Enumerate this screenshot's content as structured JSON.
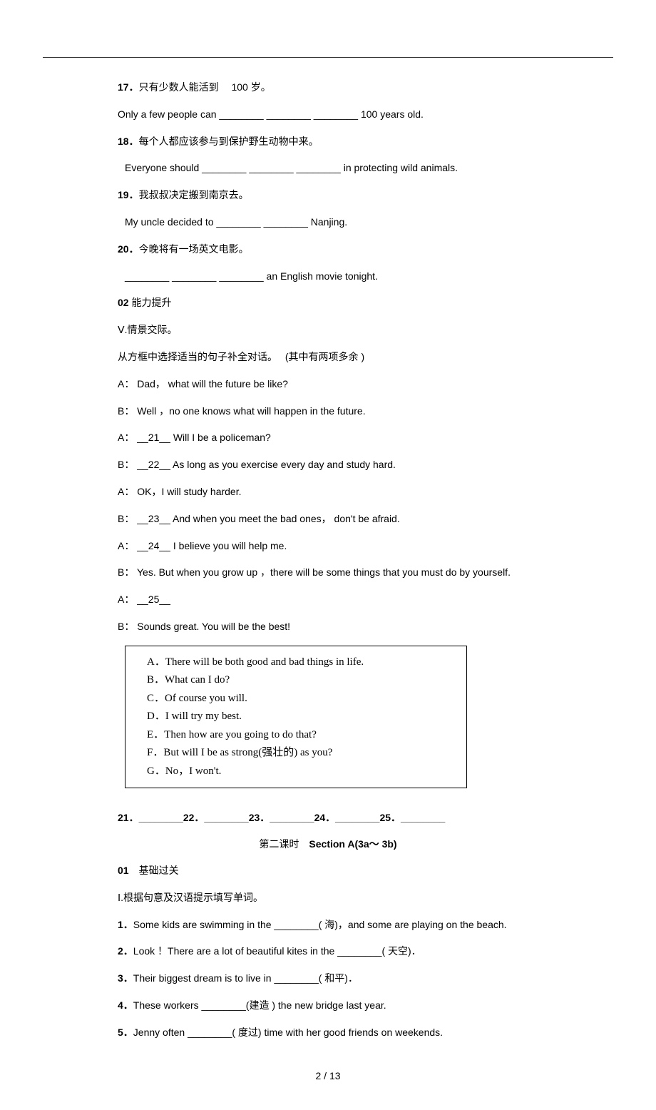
{
  "q17": {
    "num": "17．",
    "zh": "只有少数人能活到　 100 岁。",
    "en": "Only a few people can ________ ________ ________ 100 years old."
  },
  "q18": {
    "num": "18．",
    "zh": "每个人都应该参与到保护野生动物中来。",
    "en": "Everyone should ________ ________ ________ in protecting wild animals."
  },
  "q19": {
    "num": "19．",
    "zh": "我叔叔决定搬到南京去。",
    "en": "My uncle decided to ________ ________ Nanjing."
  },
  "q20": {
    "num": "20．",
    "zh": "今晚将有一场英文电影。",
    "en": "________ ________ ________ an English movie tonight."
  },
  "sec02": {
    "label": "02",
    "title": "能力提升"
  },
  "part5": {
    "label": "Ⅴ.情景交际。",
    "instr": "从方框中选择适当的句子补全对话。　 (其中有两项多余  )"
  },
  "dialogue": [
    "A： Dad， what will the future be like?",
    "B： Well ，no one knows what will happen in the future.",
    "A： __21__ Will I be a policeman?",
    "B： __22__ As long as you exercise every day and study hard.",
    "A： OK，I will study harder.",
    "B： __23__ And when you meet the bad ones， don't be afraid.",
    "A： __24__ I believe you will help me.",
    "B： Yes. But when you grow up  ，there will be some things that you must do by yourself.",
    "A： __25__",
    "B： Sounds great. You will be the best!"
  ],
  "options": [
    "A．There will be both good and bad things in life.",
    "B．What can I do?",
    "C．Of course you will.",
    "D．I will try my best.",
    "E．Then how are you going to do that?",
    "F．But will I be as strong(强壮的) as you?",
    "G．No，I won't."
  ],
  "answers_line": "21．________22．________23．________24．________25．________",
  "section_title_prefix": "第二课时　",
  "section_title_bold": "Section A(3a～ 3b)",
  "sec01": {
    "label": "01",
    "title": "　基础过关"
  },
  "part1": {
    "label": "Ⅰ.根据句意及汉语提示填写单词。"
  },
  "vocab": [
    {
      "num": "1．",
      "txt": "Some kids are swimming in the ________(  海)，and some are playing on the beach."
    },
    {
      "num": "2．",
      "txt": "Look ！There are a lot of beautiful kites in the ________(  天空)．"
    },
    {
      "num": "3．",
      "txt": "Their biggest dream is to live in ________(  和平)．"
    },
    {
      "num": "4．",
      "txt": "These workers ________(建造 ) the new bridge last year."
    },
    {
      "num": "5．",
      "txt": "Jenny often ________( 度过) time with her good friends on weekends."
    }
  ],
  "footer": "2 / 13"
}
